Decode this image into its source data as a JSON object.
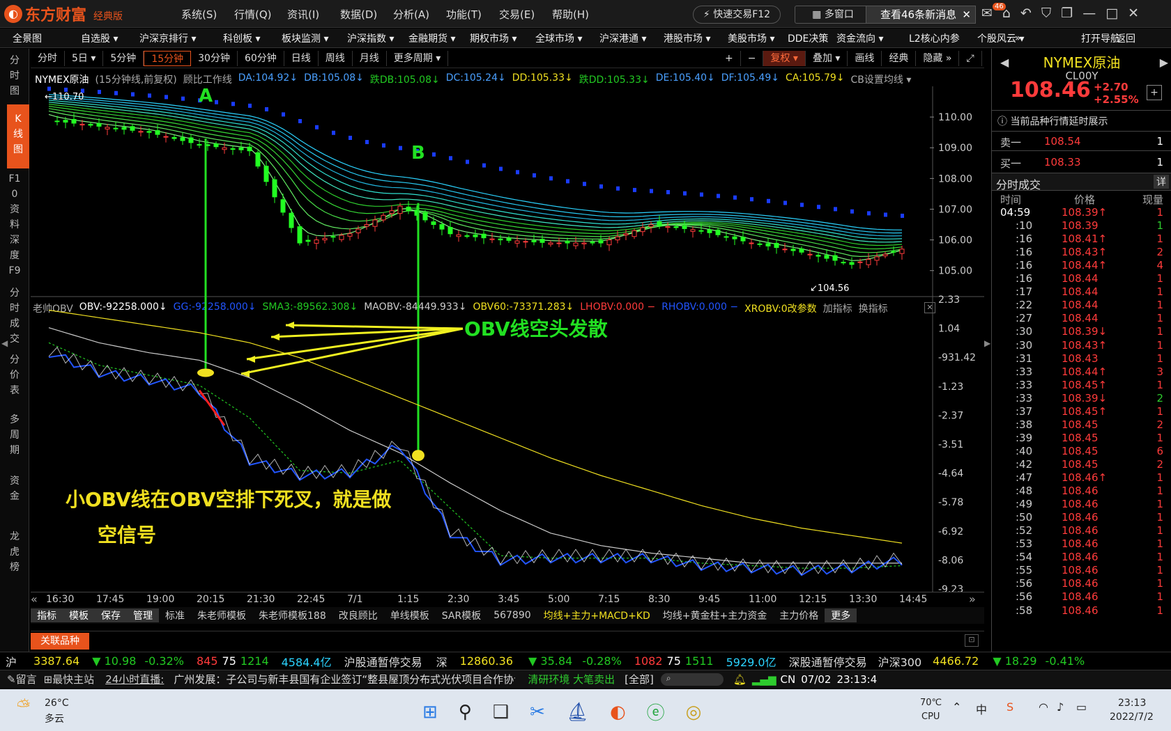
{
  "app": {
    "logo_text": "东方财富",
    "edition": "经典版",
    "menu": [
      "系统(S)",
      "行情(Q)",
      "资讯(I)",
      "数据(D)",
      "分析(A)",
      "功能(T)",
      "交易(E)",
      "帮助(H)"
    ],
    "fast_trade": "快速交易F12",
    "multi_window": "多窗口",
    "message": "查看46条新消息",
    "msg_badge": "46"
  },
  "navbar": [
    "全景图",
    "自选股 ▾",
    "沪深京排行 ▾",
    "科创板 ▾",
    "板块监测 ▾",
    "沪深指数 ▾",
    "金融期货 ▾",
    "期权市场 ▾",
    "全球市场 ▾",
    "沪深港通 ▾",
    "港股市场 ▾",
    "美股市场 ▾",
    "DDE决策",
    "资金流向 ▾",
    "L2核心内参",
    "个股风云 ▾",
    "»",
    "打开导航",
    "返回"
  ],
  "left_tabs": [
    {
      "label": "分时图"
    },
    {
      "label": "K线图",
      "active": true
    },
    {
      "label": "F10资料"
    },
    {
      "label": "深度F9"
    },
    {
      "label": "分时成交"
    },
    {
      "label": "分价表"
    },
    {
      "label": "多周期"
    },
    {
      "label": "资金"
    },
    {
      "label": "龙虎榜"
    }
  ],
  "periods": [
    "分时",
    "5日 ▾",
    "5分钟",
    "15分钟",
    "30分钟",
    "60分钟",
    "日线",
    "周线",
    "月线",
    "更多周期 ▾"
  ],
  "active_period": "15分钟",
  "chart_tools": [
    "+",
    "−",
    "复权 ▾",
    "叠加 ▾",
    "画线",
    "经典",
    "隐藏 »"
  ],
  "ma_legend": [
    {
      "text": "NYMEX原油",
      "color": "#ffffff"
    },
    {
      "text": "(15分钟线,前复权)",
      "color": "#aaaaaa"
    },
    {
      "text": "顾比工作线",
      "color": "#aaaaaa"
    },
    {
      "text": "DA:104.92↓",
      "color": "#4aa0ff"
    },
    {
      "text": "DB:105.08↓",
      "color": "#4aa0ff"
    },
    {
      "text": "跌DB:105.08↓",
      "color": "#22c922"
    },
    {
      "text": "DC:105.24↓",
      "color": "#4aa0ff"
    },
    {
      "text": "DD:105.33↓",
      "color": "#f0e020"
    },
    {
      "text": "跌DD:105.33↓",
      "color": "#22c922"
    },
    {
      "text": "DE:105.40↓",
      "color": "#4aa0ff"
    },
    {
      "text": "DF:105.49↓",
      "color": "#4aa0ff"
    },
    {
      "text": "CA:105.79↓",
      "color": "#f0e020"
    },
    {
      "text": "CB设置均线 ▾",
      "color": "#aaaaaa"
    }
  ],
  "obv_legend": [
    {
      "text": "老帅OBV",
      "color": "#aaaaaa"
    },
    {
      "text": "OBV:-92258.000↓",
      "color": "#ffffff"
    },
    {
      "text": "GG:-92258.000↓",
      "color": "#2255ff"
    },
    {
      "text": "SMA3:-89562.308↓",
      "color": "#22c922"
    },
    {
      "text": "MAOBV:-84449.933↓",
      "color": "#cccccc"
    },
    {
      "text": "OBV60:-73371.283↓",
      "color": "#f0e020"
    },
    {
      "text": "LHOBV:0.000 −",
      "color": "#ff3b3b"
    },
    {
      "text": "RHOBV:0.000 −",
      "color": "#2255ff"
    },
    {
      "text": "XROBV:0改参数",
      "color": "#f0e020"
    },
    {
      "text": "加指标",
      "color": "#aaaaaa"
    },
    {
      "text": "换指标",
      "color": "#aaaaaa"
    }
  ],
  "price_axis": [
    "110.00",
    "109.00",
    "108.00",
    "107.00",
    "106.00",
    "105.00"
  ],
  "obv_axis": [
    "2.33",
    "1.04",
    "-931.42",
    "-1.23",
    "-2.37",
    "-3.51",
    "-4.64",
    "-5.78",
    "-6.92",
    "-8.06",
    "-9.23"
  ],
  "time_axis": [
    "16:30",
    "17:45",
    "19:00",
    "20:15",
    "21:30",
    "22:45",
    "7/1",
    "1:15",
    "2:30",
    "3:45",
    "5:00",
    "7:15",
    "8:30",
    "9:45",
    "11:00",
    "12:15",
    "13:30",
    "14:45"
  ],
  "labels": {
    "high": "110.70",
    "low": "104.56",
    "A": "A",
    "B": "B",
    "obv_diverge": "OBV线空头发散",
    "note_line1": "小OBV线在OBV空排下死叉，就是做",
    "note_line2": "空信号"
  },
  "template_bar": [
    "指标",
    "模板",
    "保存",
    "管理",
    "标准",
    "朱老师模板",
    "朱老师模板188",
    "改良顾比",
    "单线模板",
    "SAR模板",
    "567890",
    "均线+主力+MACD+KD",
    "均线+黄金柱+主力资金",
    "主力价格",
    "更多"
  ],
  "related_btn": "关联品种",
  "quote": {
    "name": "NYMEX原油",
    "code": "CL00Y",
    "price": "108.46",
    "change": "+2.70",
    "pct": "+2.55%",
    "delay_note": "当前品种行情延时展示",
    "ask_label": "卖一",
    "ask": "108.54",
    "ask_vol": "1",
    "bid_label": "买一",
    "bid": "108.33",
    "bid_vol": "1",
    "trades_title": "分时成交",
    "trades_btn": "详",
    "col_time": "时间",
    "col_price": "价格",
    "col_vol": "现量"
  },
  "trades": [
    {
      "t": "04:59",
      "p": "108.39↑",
      "v": "1",
      "g": false
    },
    {
      "t": ":10",
      "p": "108.39",
      "v": "1",
      "g": true
    },
    {
      "t": ":16",
      "p": "108.41↑",
      "v": "1",
      "g": false
    },
    {
      "t": ":16",
      "p": "108.43↑",
      "v": "2",
      "g": false
    },
    {
      "t": ":16",
      "p": "108.44↑",
      "v": "4",
      "g": false
    },
    {
      "t": ":16",
      "p": "108.44",
      "v": "1",
      "g": false
    },
    {
      "t": ":17",
      "p": "108.44",
      "v": "1",
      "g": false
    },
    {
      "t": ":22",
      "p": "108.44",
      "v": "1",
      "g": false
    },
    {
      "t": ":27",
      "p": "108.44",
      "v": "1",
      "g": false
    },
    {
      "t": ":30",
      "p": "108.39↓",
      "v": "1",
      "g": false
    },
    {
      "t": ":30",
      "p": "108.43↑",
      "v": "1",
      "g": false
    },
    {
      "t": ":31",
      "p": "108.43",
      "v": "1",
      "g": false
    },
    {
      "t": ":33",
      "p": "108.44↑",
      "v": "3",
      "g": false
    },
    {
      "t": ":33",
      "p": "108.45↑",
      "v": "1",
      "g": false
    },
    {
      "t": ":33",
      "p": "108.39↓",
      "v": "2",
      "g": true
    },
    {
      "t": ":37",
      "p": "108.45↑",
      "v": "1",
      "g": false
    },
    {
      "t": ":38",
      "p": "108.45",
      "v": "2",
      "g": false
    },
    {
      "t": ":39",
      "p": "108.45",
      "v": "1",
      "g": false
    },
    {
      "t": ":40",
      "p": "108.45",
      "v": "6",
      "g": false
    },
    {
      "t": ":42",
      "p": "108.45",
      "v": "2",
      "g": false
    },
    {
      "t": ":47",
      "p": "108.46↑",
      "v": "1",
      "g": false
    },
    {
      "t": ":48",
      "p": "108.46",
      "v": "1",
      "g": false
    },
    {
      "t": ":49",
      "p": "108.46",
      "v": "1",
      "g": false
    },
    {
      "t": ":50",
      "p": "108.46",
      "v": "1",
      "g": false
    },
    {
      "t": ":52",
      "p": "108.46",
      "v": "1",
      "g": false
    },
    {
      "t": ":53",
      "p": "108.46",
      "v": "1",
      "g": false
    },
    {
      "t": ":54",
      "p": "108.46",
      "v": "1",
      "g": false
    },
    {
      "t": ":55",
      "p": "108.46",
      "v": "1",
      "g": false
    },
    {
      "t": ":56",
      "p": "108.46",
      "v": "1",
      "g": false
    },
    {
      "t": ":56",
      "p": "108.46",
      "v": "1",
      "g": false
    },
    {
      "t": ":58",
      "p": "108.46",
      "v": "1",
      "g": false
    }
  ],
  "indexbar": {
    "sh": "沪",
    "sh_val": "3387.64",
    "sh_chg": "▼ 10.98",
    "sh_pct": "-0.32%",
    "sh_up": "845",
    "sh_eq": "75",
    "sh_dn": "1214",
    "sh_amt": "4584.4亿",
    "sh_note": "沪股通暂停交易",
    "sz": "深",
    "sz_val": "12860.36",
    "sz_chg": "▼ 35.84",
    "sz_pct": "-0.28%",
    "sz_up": "1082",
    "sz_eq": "75",
    "sz_dn": "1511",
    "sz_amt": "5929.0亿",
    "sz_note": "深股通暂停交易",
    "hs": "沪深300",
    "hs_val": "4466.72",
    "hs_chg": "▼ 18.29",
    "hs_pct": "-0.41%"
  },
  "newsbar": {
    "msg": "留言",
    "main": "最快主站",
    "live": "24小时直播:",
    "news": "广州发展：子公司与新丰县国有企业签订“整县屋顶分布式光伏项目合作协议”",
    "env": "清研环境 大笔卖出",
    "all": "[全部]",
    "cn": "CN",
    "date": "07/02",
    "time": "23:13:4"
  },
  "taskbar": {
    "temp": "26°C",
    "weather": "多云",
    "cpu_temp": "70℃",
    "cpu": "CPU",
    "clock": "23:13",
    "date": "2022/7/2"
  },
  "chart_data": {
    "type": "candlestick",
    "title": "NYMEX原油 (15分钟线,前复权)",
    "x": [
      "16:30",
      "17:45",
      "19:00",
      "20:15",
      "21:30",
      "22:45",
      "7/1",
      "1:15",
      "2:30",
      "3:45",
      "5:00",
      "7:15",
      "8:30",
      "9:45",
      "11:00",
      "12:15",
      "13:30",
      "14:45"
    ],
    "close_approx": [
      109.9,
      109.7,
      109.5,
      109.1,
      108.9,
      105.9,
      106.2,
      107.1,
      106.2,
      106.0,
      105.9,
      105.9,
      106.5,
      106.3,
      105.9,
      105.6,
      105.2,
      105.7
    ],
    "ylim": [
      104.2,
      111.0
    ],
    "annotations": [
      {
        "label": "A",
        "x": "20:15",
        "price": 109.3
      },
      {
        "label": "B",
        "x": "1:15",
        "price": 107.2
      }
    ],
    "obv_ylim": [
      -9.23,
      2.33
    ],
    "series": [
      {
        "name": "OBV",
        "values": [
          0.2,
          -0.6,
          -0.9,
          -1.3,
          -4.1,
          -4.7,
          -4.6,
          -3.5,
          -7.0,
          -8.1,
          -8.0,
          -8.0,
          -8.0,
          -8.3,
          -8.4,
          -8.5,
          -8.4,
          -8.1
        ]
      },
      {
        "name": "SMA3",
        "values": [
          0.6,
          -0.3,
          -0.7,
          -1.1,
          -2.4,
          -4.5,
          -4.6,
          -4.1,
          -6.0,
          -7.9,
          -8.0,
          -8.0,
          -8.0,
          -8.2,
          -8.3,
          -8.4,
          -8.4,
          -8.3
        ]
      },
      {
        "name": "MAOBV",
        "values": [
          1.2,
          0.6,
          0.2,
          -0.1,
          -0.8,
          -1.8,
          -2.9,
          -3.8,
          -5.0,
          -6.1,
          -7.0,
          -7.5,
          -7.8,
          -8.0,
          -8.2,
          -8.2,
          -8.2,
          -8.2
        ]
      },
      {
        "name": "OBV60",
        "values": [
          1.9,
          1.6,
          1.3,
          1.0,
          0.6,
          0.0,
          -0.8,
          -1.6,
          -2.4,
          -3.2,
          -4.0,
          -4.7,
          -5.3,
          -5.9,
          -6.4,
          -6.8,
          -7.1,
          -7.4
        ]
      }
    ]
  }
}
